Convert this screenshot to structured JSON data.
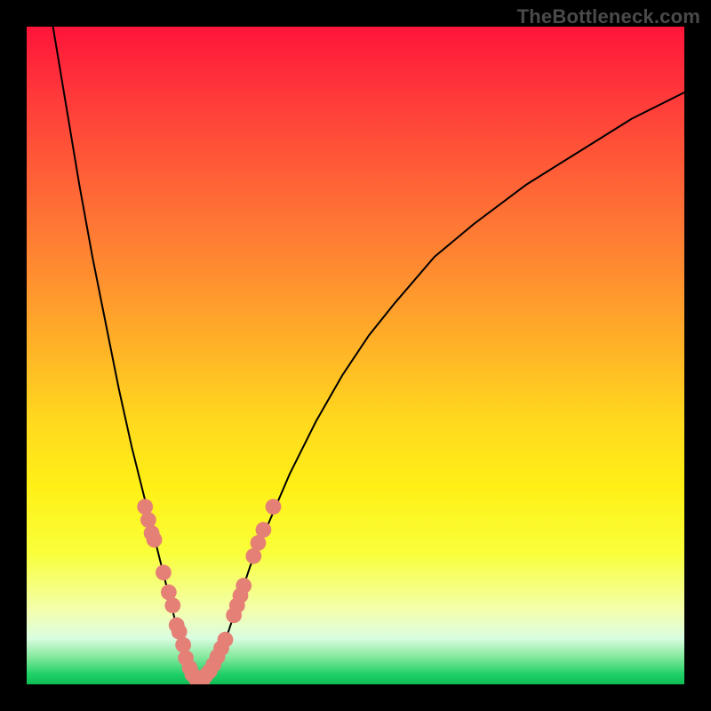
{
  "watermark": "TheBottleneck.com",
  "chart_data": {
    "type": "line",
    "title": "",
    "xlabel": "",
    "ylabel": "",
    "xlim": [
      0,
      100
    ],
    "ylim": [
      0,
      100
    ],
    "grid": false,
    "background_gradient": {
      "orientation": "vertical",
      "stops": [
        {
          "pos": 0.0,
          "color": "#ff143a"
        },
        {
          "pos": 0.12,
          "color": "#ff3e3a"
        },
        {
          "pos": 0.26,
          "color": "#ff6a36"
        },
        {
          "pos": 0.38,
          "color": "#ff8f30"
        },
        {
          "pos": 0.5,
          "color": "#ffb726"
        },
        {
          "pos": 0.6,
          "color": "#ffd91e"
        },
        {
          "pos": 0.7,
          "color": "#fff016"
        },
        {
          "pos": 0.8,
          "color": "#f9ff3a"
        },
        {
          "pos": 0.89,
          "color": "#f3ffb0"
        },
        {
          "pos": 0.93,
          "color": "#dafde0"
        },
        {
          "pos": 0.96,
          "color": "#7fe899"
        },
        {
          "pos": 0.985,
          "color": "#1fd066"
        },
        {
          "pos": 1.0,
          "color": "#0ebd55"
        }
      ]
    },
    "series": [
      {
        "name": "curve",
        "color": "#000000",
        "stroke_width": 2,
        "x": [
          4,
          6,
          8,
          10,
          12,
          14,
          16,
          18,
          20,
          22,
          23,
          24,
          25,
          26,
          27,
          28,
          30,
          32,
          34,
          37,
          40,
          44,
          48,
          52,
          56,
          62,
          68,
          76,
          84,
          92,
          100
        ],
        "y": [
          100,
          88,
          76,
          65,
          55,
          45,
          36,
          28,
          20,
          12,
          8,
          5,
          2,
          0,
          0,
          2,
          6,
          12,
          18,
          25,
          32,
          40,
          47,
          53,
          58,
          65,
          70,
          76,
          81,
          86,
          90
        ]
      }
    ],
    "scatter": [
      {
        "name": "dots",
        "color": "#e58077",
        "radius": 1.2,
        "points": [
          {
            "x": 18.0,
            "y": 27
          },
          {
            "x": 18.5,
            "y": 25
          },
          {
            "x": 19.0,
            "y": 23
          },
          {
            "x": 19.4,
            "y": 22
          },
          {
            "x": 20.8,
            "y": 17
          },
          {
            "x": 21.6,
            "y": 14
          },
          {
            "x": 22.2,
            "y": 12
          },
          {
            "x": 22.8,
            "y": 9
          },
          {
            "x": 23.2,
            "y": 8
          },
          {
            "x": 23.8,
            "y": 6
          },
          {
            "x": 24.2,
            "y": 4
          },
          {
            "x": 24.8,
            "y": 2.5
          },
          {
            "x": 25.2,
            "y": 1.5
          },
          {
            "x": 25.8,
            "y": 0.8
          },
          {
            "x": 26.2,
            "y": 0.5
          },
          {
            "x": 26.8,
            "y": 0.8
          },
          {
            "x": 27.2,
            "y": 1.3
          },
          {
            "x": 27.8,
            "y": 2.0
          },
          {
            "x": 28.4,
            "y": 3.0
          },
          {
            "x": 29.0,
            "y": 4.2
          },
          {
            "x": 29.6,
            "y": 5.5
          },
          {
            "x": 30.2,
            "y": 6.8
          },
          {
            "x": 31.5,
            "y": 10.5
          },
          {
            "x": 32.0,
            "y": 12.0
          },
          {
            "x": 32.5,
            "y": 13.5
          },
          {
            "x": 33.0,
            "y": 15.0
          },
          {
            "x": 34.5,
            "y": 19.5
          },
          {
            "x": 35.2,
            "y": 21.5
          },
          {
            "x": 36.0,
            "y": 23.5
          },
          {
            "x": 37.5,
            "y": 27
          }
        ]
      }
    ]
  }
}
